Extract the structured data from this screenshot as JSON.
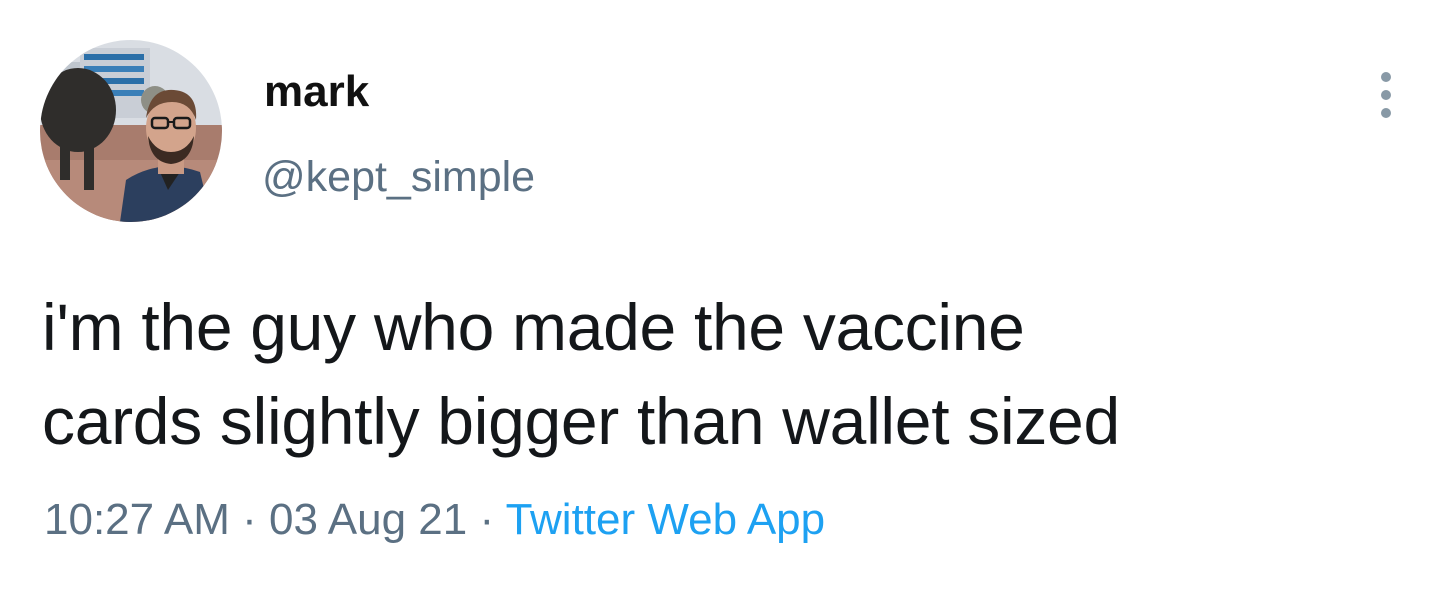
{
  "tweet": {
    "author": {
      "display_name": "mark",
      "handle": "@kept_simple",
      "avatar_icon": "profile-photo"
    },
    "text_lines": [
      "i'm the guy who made the vaccine",
      "cards slightly bigger than wallet sized"
    ],
    "meta": {
      "time": "10:27 AM",
      "separator": "·",
      "date": "03 Aug 21",
      "source": "Twitter Web App"
    },
    "more_icon": "more-vertical-icon"
  },
  "colors": {
    "text": "#14171a",
    "secondary": "#5b7083",
    "link": "#1da1f2",
    "background": "#ffffff"
  }
}
